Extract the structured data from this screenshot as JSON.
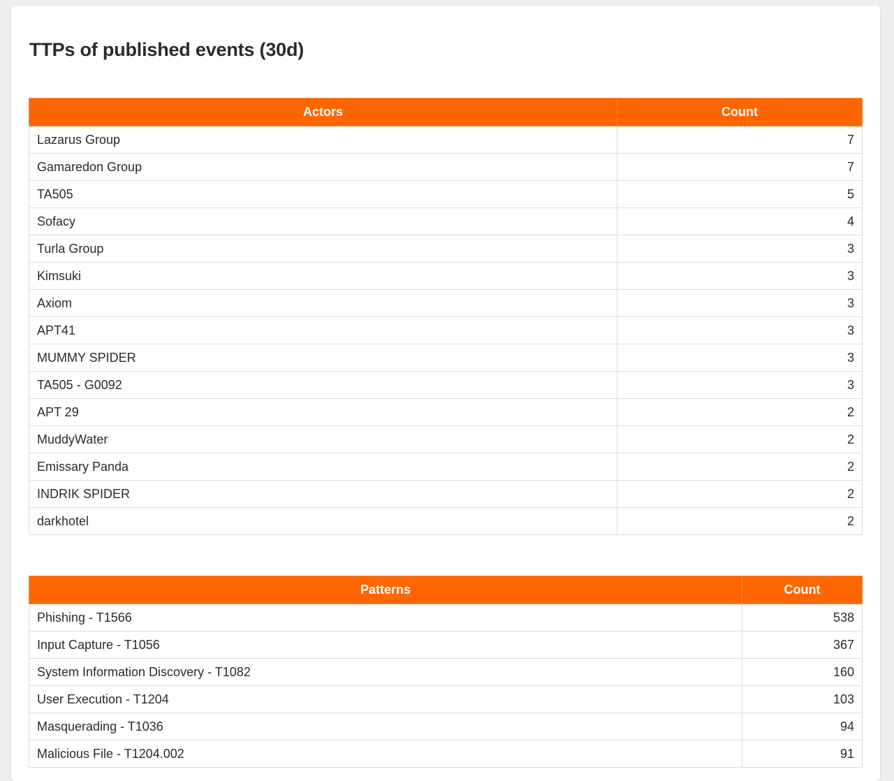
{
  "title": "TTPs of published events (30d)",
  "colors": {
    "header_bg": "#ff6600",
    "header_text": "#ffffff"
  },
  "actors_table": {
    "headers": [
      "Actors",
      "Count"
    ],
    "rows": [
      {
        "name": "Lazarus Group",
        "count": "7"
      },
      {
        "name": "Gamaredon Group",
        "count": "7"
      },
      {
        "name": "TA505",
        "count": "5"
      },
      {
        "name": "Sofacy",
        "count": "4"
      },
      {
        "name": "Turla Group",
        "count": "3"
      },
      {
        "name": "Kimsuki",
        "count": "3"
      },
      {
        "name": "Axiom",
        "count": "3"
      },
      {
        "name": "APT41",
        "count": "3"
      },
      {
        "name": "MUMMY SPIDER",
        "count": "3"
      },
      {
        "name": "TA505 - G0092",
        "count": "3"
      },
      {
        "name": "APT 29",
        "count": "2"
      },
      {
        "name": "MuddyWater",
        "count": "2"
      },
      {
        "name": "Emissary Panda",
        "count": "2"
      },
      {
        "name": "INDRIK SPIDER",
        "count": "2"
      },
      {
        "name": "darkhotel",
        "count": "2"
      }
    ]
  },
  "patterns_table": {
    "headers": [
      "Patterns",
      "Count"
    ],
    "rows": [
      {
        "name": "Phishing - T1566",
        "count": "538"
      },
      {
        "name": "Input Capture - T1056",
        "count": "367"
      },
      {
        "name": "System Information Discovery - T1082",
        "count": "160"
      },
      {
        "name": "User Execution - T1204",
        "count": "103"
      },
      {
        "name": "Masquerading - T1036",
        "count": "94"
      },
      {
        "name": "Malicious File - T1204.002",
        "count": "91"
      }
    ]
  }
}
